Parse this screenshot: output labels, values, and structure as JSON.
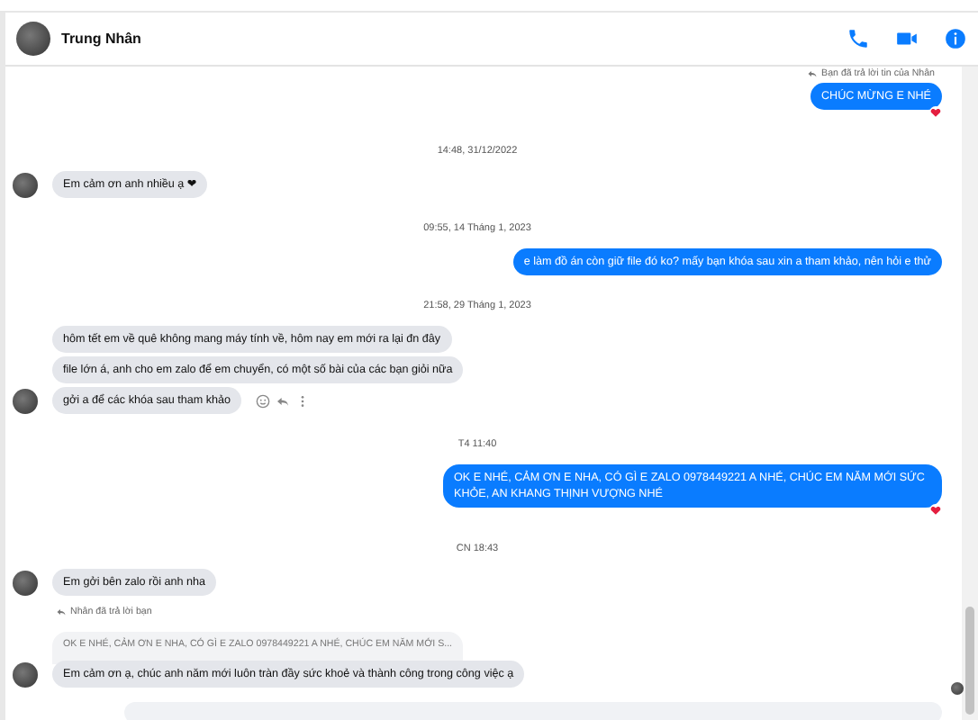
{
  "header": {
    "name": "Trung Nhân"
  },
  "messages": [
    {
      "kind": "reply_out",
      "text": "Bạn đã trả lời tin của Nhân"
    },
    {
      "kind": "out",
      "text": "CHÚC MỪNG E NHÉ",
      "reaction": true
    },
    {
      "kind": "time",
      "text": "14:48, 31/12/2022"
    },
    {
      "kind": "in",
      "text": "Em cảm ơn anh nhiều ạ ❤",
      "avatar": true,
      "actions": false
    },
    {
      "kind": "time",
      "text": "09:55, 14 Tháng 1, 2023"
    },
    {
      "kind": "out",
      "text": "e làm đồ án còn giữ file đó ko? mấy bạn khóa sau xin a tham khảo, nên hỏi e thử",
      "reaction": false
    },
    {
      "kind": "time",
      "text": "21:58, 29 Tháng 1, 2023"
    },
    {
      "kind": "in",
      "text": "hôm tết em về quê không mang máy tính về, hôm nay em mới ra lại đn đây",
      "avatar": false,
      "actions": false
    },
    {
      "kind": "in",
      "text": "file lớn á, anh cho em zalo để em chuyển, có một số bài của các bạn giỏi nữa",
      "avatar": false,
      "actions": false
    },
    {
      "kind": "in",
      "text": "gởi a để các khóa sau tham khảo",
      "avatar": true,
      "actions": true
    },
    {
      "kind": "time",
      "text": "T4 11:40"
    },
    {
      "kind": "out",
      "text": "OK E NHÉ, CẢM ƠN E NHA, CÓ GÌ E ZALO 0978449221 A NHÉ, CHÚC EM NĂM MỚI SỨC KHỎE, AN KHANG THỊNH VƯỢNG NHÉ",
      "reaction": true
    },
    {
      "kind": "time",
      "text": "CN 18:43"
    },
    {
      "kind": "in",
      "text": "Em gởi bên zalo rồi anh nha",
      "avatar": true,
      "actions": false
    },
    {
      "kind": "reply_in",
      "text": "Nhân đã trả lời bạn"
    },
    {
      "kind": "quote",
      "text": "OK E NHÉ, CẢM ƠN E NHA, CÓ GÌ E ZALO 0978449221 A NHÉ, CHÚC EM NĂM MỚI S..."
    },
    {
      "kind": "in",
      "text": "Em cảm ơn ạ, chúc anh năm mới luôn tràn đầy sức khoẻ và thành công trong công việc ạ",
      "avatar": true,
      "actions": false
    }
  ]
}
